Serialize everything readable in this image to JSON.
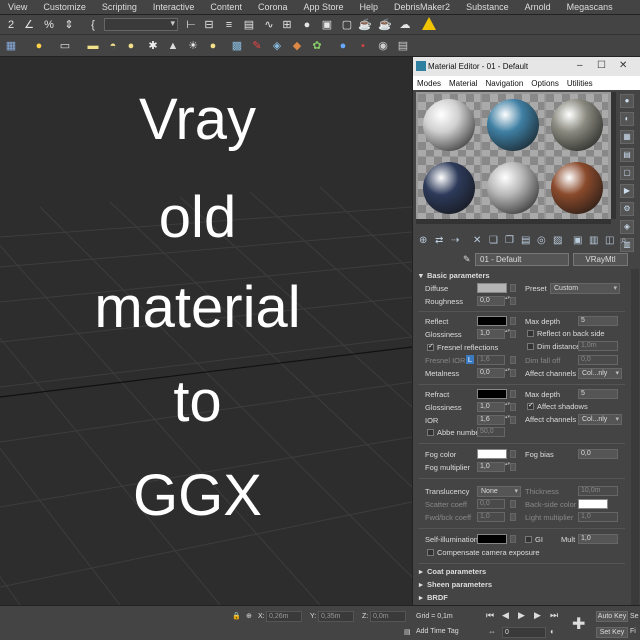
{
  "menu": [
    "View",
    "Customize",
    "Scripting",
    "Interactive",
    "Content",
    "Corona",
    "App Store",
    "Help",
    "DebrisMaker2",
    "Substance",
    "Arnold",
    "Megascans"
  ],
  "viewport": {
    "overlay_lines": [
      "Vray",
      "old",
      "material",
      "to",
      "GGX"
    ]
  },
  "material_editor": {
    "title": "Material Editor - 01 - Default",
    "menu": [
      "Modes",
      "Material",
      "Navigation",
      "Options",
      "Utilities"
    ],
    "material_name": "01 - Default",
    "material_type": "VRayMtl",
    "samples": [
      {
        "color": "#d0d0d0",
        "selected": true
      },
      {
        "color": "#3f7fa3",
        "selected": false
      },
      {
        "color": "#8a8a80",
        "selected": false
      },
      {
        "color": "#2d3a5a",
        "selected": false
      },
      {
        "color": "#b8b8b8",
        "selected": false
      },
      {
        "color": "#8a4a2c",
        "selected": false
      }
    ],
    "rollouts": {
      "basic": "Basic parameters",
      "coat": "Coat parameters",
      "sheen": "Sheen parameters",
      "brdf": "BRDF"
    },
    "basic": {
      "diffuse": "Diffuse",
      "roughness": "Roughness",
      "roughness_val": "0,0",
      "preset": "Preset",
      "preset_val": "Custom",
      "reflect": "Reflect",
      "glossiness": "Glossiness",
      "refl_gloss_val": "1,0",
      "fresnel": "Fresnel reflections",
      "fresnel_ior": "Fresnel IOR",
      "fresnel_ior_val": "1,6",
      "metalness": "Metalness",
      "metalness_val": "0,0",
      "max_depth": "Max depth",
      "refl_max_depth_val": "5",
      "reflect_back": "Reflect on back side",
      "dim_distance": "Dim distance",
      "dim_distance_val": "1,0m",
      "dim_falloff": "Dim fall off",
      "dim_falloff_val": "0,0",
      "affect_channels": "Affect channels",
      "affect_channels_val": "Col...nly",
      "refract": "Refract",
      "refr_gloss_val": "1,0",
      "ior": "IOR",
      "ior_val": "1,6",
      "abbe": "Abbe number",
      "abbe_val": "50,0",
      "refr_max_depth_val": "5",
      "affect_shadows": "Affect shadows",
      "fog_color": "Fog color",
      "fog_multiplier": "Fog multiplier",
      "fog_multiplier_val": "1,0",
      "fog_bias": "Fog bias",
      "fog_bias_val": "0,0",
      "translucency": "Translucency",
      "translucency_val": "None",
      "scatter_coeff": "Scatter coeff",
      "scatter_coeff_val": "0,0",
      "fwd_bck_coeff": "Fwd/bck coeff",
      "fwd_bck_coeff_val": "1,0",
      "thickness": "Thickness",
      "thickness_val": "10,0m",
      "back_side_color": "Back-side color",
      "light_multiplier": "Light multiplier",
      "light_multiplier_val": "1,0",
      "self_illum": "Self-illumination",
      "gi": "GI",
      "mult": "Mult",
      "mult_val": "1,0",
      "compensate": "Compensate camera exposure",
      "ior_badge": "L"
    }
  },
  "status": {
    "x_label": "X:",
    "x": "0,26m",
    "y_label": "Y:",
    "y": "0,35m",
    "z_label": "Z:",
    "z": "0,0m",
    "grid": "Grid = 0,1m",
    "add_time_tag": "Add Time Tag",
    "frame": "0",
    "auto_key": "Auto Key",
    "set_key": "Set Key",
    "sel_label": "Se",
    "filter_label": "Fi"
  },
  "colors": {
    "diffuse": "#b4b4b4",
    "reflect": "#000000",
    "refract": "#000000",
    "fog": "#ffffff",
    "back_side": "#ffffff",
    "self_illum": "#000000"
  }
}
